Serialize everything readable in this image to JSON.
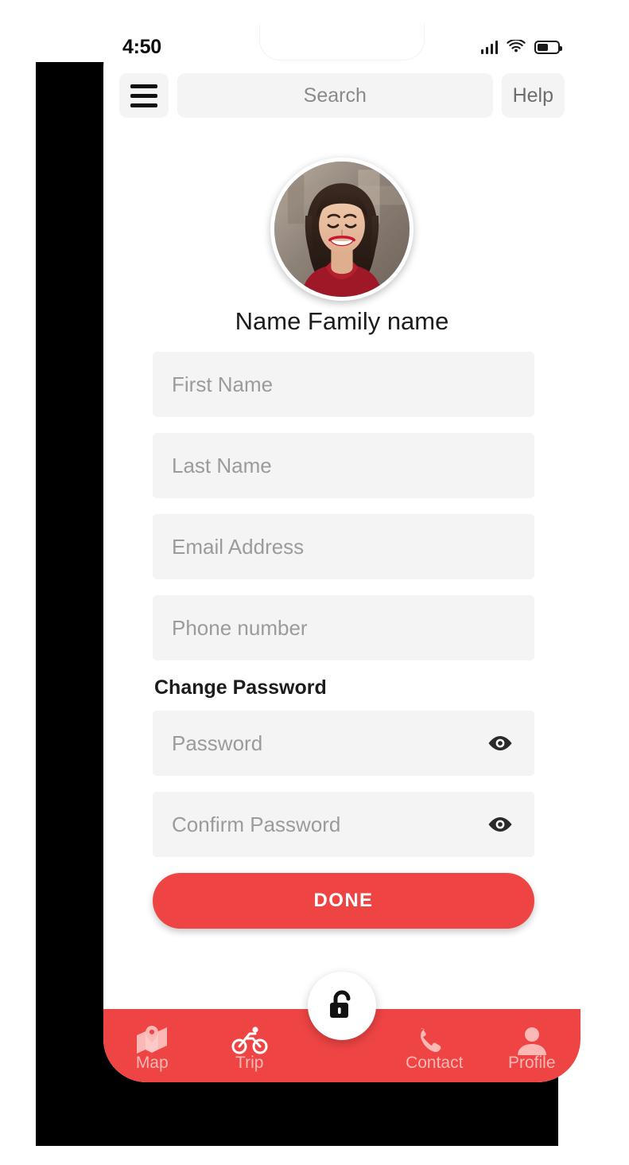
{
  "status_bar": {
    "time": "4:50",
    "signal_icon": "cellular-signal-icon",
    "wifi_icon": "wifi-icon",
    "battery_icon": "battery-icon",
    "battery_level_percent": 45
  },
  "app_bar": {
    "menu_icon": "hamburger-menu-icon",
    "search_placeholder": "Search",
    "help_label": "Help"
  },
  "profile": {
    "avatar_alt": "user-avatar-photo",
    "display_name": "Name Family name"
  },
  "form": {
    "fields": [
      {
        "name": "first-name",
        "placeholder": "First Name",
        "value": ""
      },
      {
        "name": "last-name",
        "placeholder": "Last Name",
        "value": ""
      },
      {
        "name": "email-address",
        "placeholder": "Email Address",
        "value": ""
      },
      {
        "name": "phone-number",
        "placeholder": "Phone number",
        "value": ""
      }
    ],
    "change_password_label": "Change Password",
    "password_fields": [
      {
        "name": "password",
        "placeholder": "Password",
        "value": "",
        "toggle_icon": "eye-icon"
      },
      {
        "name": "confirm-password",
        "placeholder": "Confirm Password",
        "value": "",
        "toggle_icon": "eye-icon"
      }
    ],
    "submit_label": "DONE"
  },
  "fab": {
    "icon": "unlock-padlock-icon"
  },
  "bottom_nav": {
    "items": [
      {
        "label": "Map",
        "icon": "map-pin-icon",
        "active": false
      },
      {
        "label": "Trip",
        "icon": "bicycle-icon",
        "active": true
      },
      {
        "label": "Contact",
        "icon": "phone-icon",
        "active": false
      },
      {
        "label": "Profile",
        "icon": "person-icon",
        "active": false
      }
    ]
  },
  "colors": {
    "accent_red": "#EF4444",
    "field_gray": "#F4F4F4",
    "placeholder_gray": "#9B9B9B",
    "nav_inactive": "#FBB8B4",
    "nav_active": "#FFFFFF"
  }
}
